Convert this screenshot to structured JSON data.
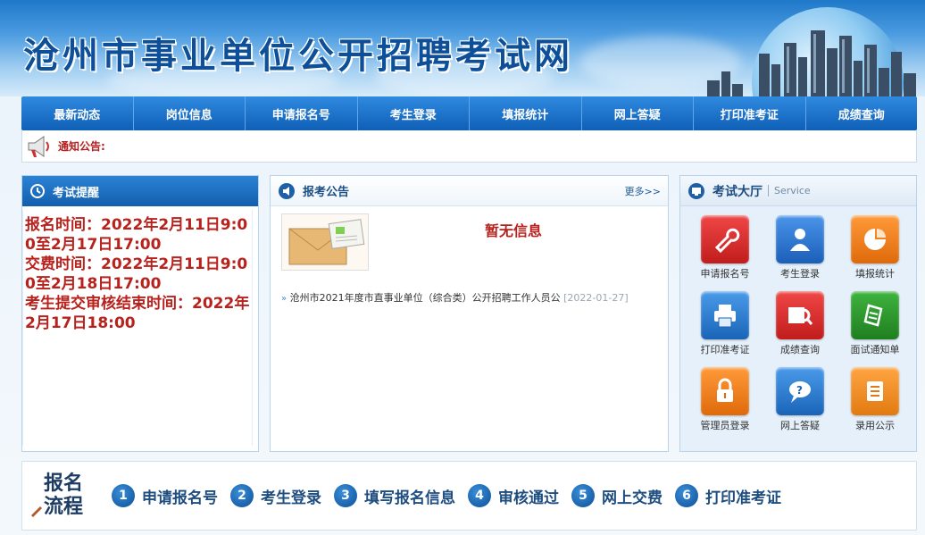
{
  "header": {
    "title": "沧州市事业单位公开招聘考试网"
  },
  "nav": {
    "items": [
      "最新动态",
      "岗位信息",
      "申请报名号",
      "考生登录",
      "填报统计",
      "网上答疑",
      "打印准考证",
      "成绩查询"
    ]
  },
  "notice": {
    "label": "通知公告:"
  },
  "exam_remind": {
    "title": "考试提醒",
    "lines": [
      "报名时间：2022年2月11日9:00至2月17日17:00",
      "交费时间：2022年2月11日9:00至2月18日17:00",
      "考生提交审核结束时间：2022年2月17日18:00"
    ]
  },
  "announce": {
    "title": "报考公告",
    "more": "更多>>",
    "no_info": "暂无信息",
    "news": [
      {
        "title": "沧州市2021年度市直事业单位（综合类）公开招聘工作人员公",
        "date": "[2022-01-27]"
      }
    ]
  },
  "hall": {
    "title": "考试大厅",
    "subtitle": "Service",
    "services": [
      {
        "label": "申请报名号",
        "icon": "wrench-icon",
        "color": "#d72a2a"
      },
      {
        "label": "考生登录",
        "icon": "user-icon",
        "color": "#2a74d1"
      },
      {
        "label": "填报统计",
        "icon": "pie-chart-icon",
        "color": "#ee7a16"
      },
      {
        "label": "打印准考证",
        "icon": "printer-icon",
        "color": "#2a80d6"
      },
      {
        "label": "成绩查询",
        "icon": "magnifier-folder-icon",
        "color": "#d72a2a"
      },
      {
        "label": "面试通知单",
        "icon": "document-notice-icon",
        "color": "#2f9a2f"
      },
      {
        "label": "管理员登录",
        "icon": "lock-icon",
        "color": "#ee7a16"
      },
      {
        "label": "网上答疑",
        "icon": "speech-bubble-icon",
        "color": "#2a80d6"
      },
      {
        "label": "录用公示",
        "icon": "notepad-icon",
        "color": "#ee8a16"
      }
    ]
  },
  "process": {
    "title_line1": "报名",
    "title_line2": "流程",
    "steps": [
      {
        "num": "1",
        "label": "申请报名号"
      },
      {
        "num": "2",
        "label": "考生登录"
      },
      {
        "num": "3",
        "label": "填写报名信息"
      },
      {
        "num": "4",
        "label": "审核通过"
      },
      {
        "num": "5",
        "label": "网上交费"
      },
      {
        "num": "6",
        "label": "打印准考证"
      }
    ]
  }
}
